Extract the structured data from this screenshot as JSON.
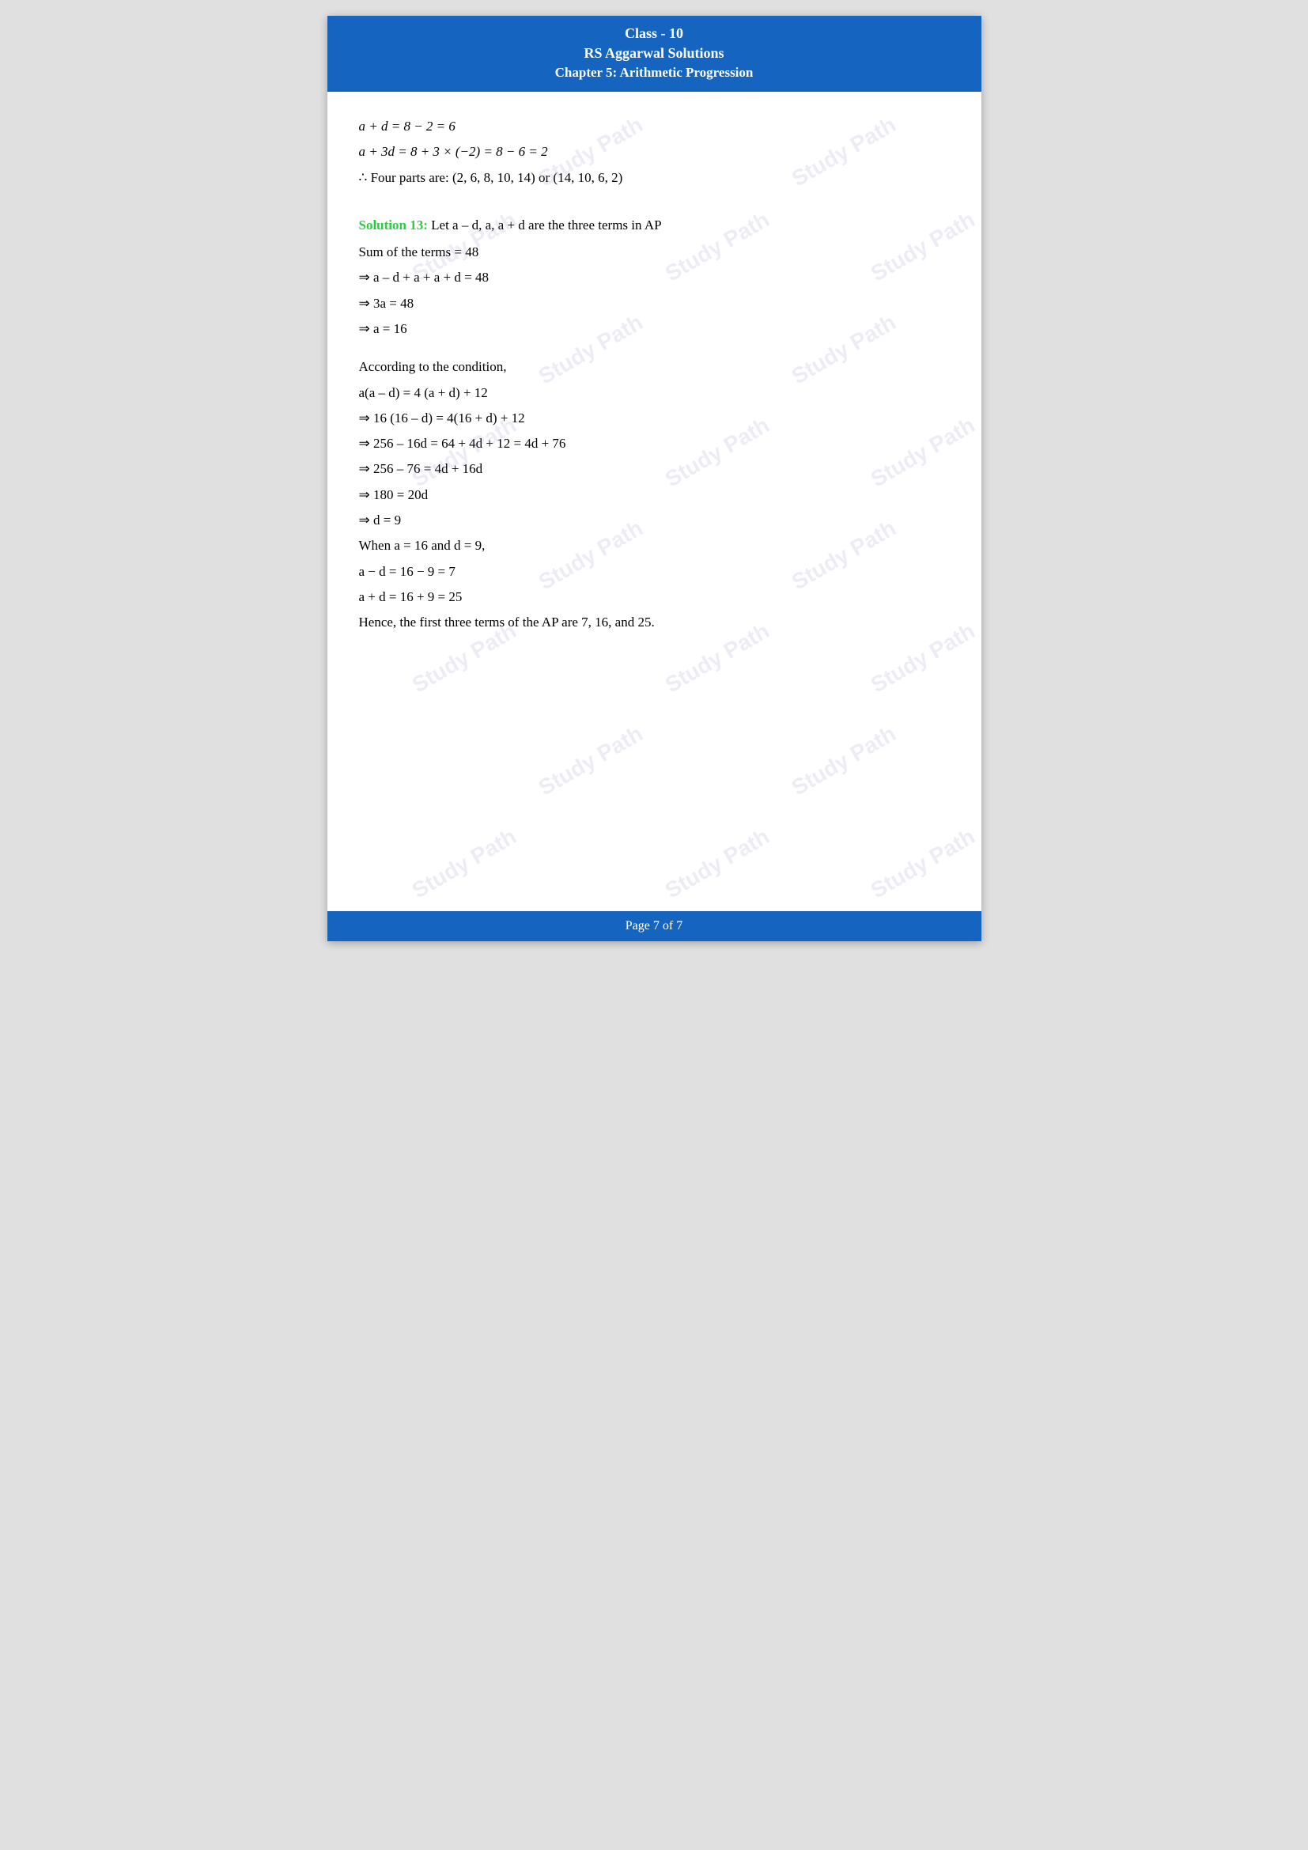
{
  "header": {
    "class_label": "Class - 10",
    "title": "RS Aggarwal Solutions",
    "chapter": "Chapter 5: Arithmetic Progression"
  },
  "content": {
    "lines": [
      {
        "id": "line1",
        "text": "a + d = 8 − 2 = 6",
        "type": "italic"
      },
      {
        "id": "line2",
        "text": "a + 3d = 8 + 3 × (−2) = 8 − 6 = 2",
        "type": "italic"
      },
      {
        "id": "line3",
        "text": "∴ Four parts are: (2, 6, 8, 10, 14) or (14, 10, 6, 2)",
        "type": "normal"
      }
    ],
    "solution13_heading": "Solution 13:",
    "solution13_intro": " Let a – d, a, a + d are the three terms in AP",
    "solution13_lines": [
      "Sum of the terms = 48",
      "⇒ a – d + a + a + d = 48",
      "⇒ 3a = 48",
      "⇒ a = 16",
      "",
      "According to the condition,",
      "a(a – d) = 4 (a + d) + 12",
      "⇒ 16 (16 – d) = 4(16 + d) + 12",
      "⇒ 256 – 16d = 64 + 4d + 12 = 4d + 76",
      "⇒ 256 – 76 = 4d + 16d",
      "⇒ 180 = 20d",
      "⇒ d = 9",
      "When a = 16 and d = 9,",
      "a − d = 16 − 9 = 7",
      "a + d = 16 + 9 = 25",
      "Hence, the first three terms of the AP are 7, 16, and 25."
    ]
  },
  "footer": {
    "page_label": "Page 7 of 7"
  },
  "watermark_text": "Study Path"
}
